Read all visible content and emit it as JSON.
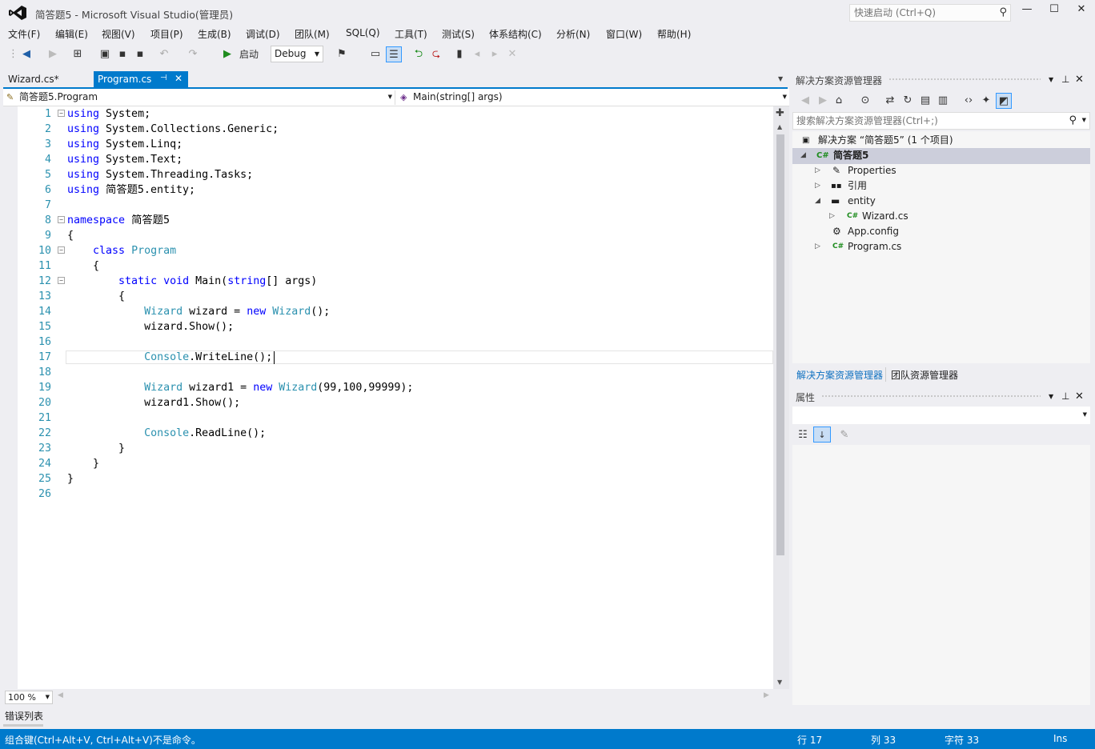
{
  "window": {
    "title": "简答题5 - Microsoft Visual Studio(管理员)",
    "quick_launch_placeholder": "快速启动 (Ctrl+Q)"
  },
  "menu": [
    "文件(F)",
    "编辑(E)",
    "视图(V)",
    "项目(P)",
    "生成(B)",
    "调试(D)",
    "团队(M)",
    "SQL(Q)",
    "工具(T)",
    "测试(S)",
    "体系结构(C)",
    "分析(N)",
    "窗口(W)",
    "帮助(H)"
  ],
  "toolbar": {
    "start_label": "启动",
    "config": "Debug"
  },
  "tabs": [
    {
      "label": "Wizard.cs*",
      "active": false
    },
    {
      "label": "Program.cs",
      "active": true
    }
  ],
  "navbar": {
    "class_scope": "简答题5.Program",
    "member_scope": "Main(string[] args)"
  },
  "code_lines": [
    {
      "n": "1",
      "code": "using System;"
    },
    {
      "n": "2",
      "code": "using System.Collections.Generic;"
    },
    {
      "n": "3",
      "code": "using System.Linq;"
    },
    {
      "n": "4",
      "code": "using System.Text;"
    },
    {
      "n": "5",
      "code": "using System.Threading.Tasks;"
    },
    {
      "n": "6",
      "code": "using 简答题5.entity;"
    },
    {
      "n": "7",
      "code": ""
    },
    {
      "n": "8",
      "code": "namespace 简答题5"
    },
    {
      "n": "9",
      "code": "{"
    },
    {
      "n": "10",
      "code": "    class Program"
    },
    {
      "n": "11",
      "code": "    {"
    },
    {
      "n": "12",
      "code": "        static void Main(string[] args)"
    },
    {
      "n": "13",
      "code": "        {"
    },
    {
      "n": "14",
      "code": "            Wizard wizard = new Wizard();"
    },
    {
      "n": "15",
      "code": "            wizard.Show();"
    },
    {
      "n": "16",
      "code": ""
    },
    {
      "n": "17",
      "code": "            Console.WriteLine();"
    },
    {
      "n": "18",
      "code": ""
    },
    {
      "n": "19",
      "code": "            Wizard wizard1 = new Wizard(99,100,99999);"
    },
    {
      "n": "20",
      "code": "            wizard1.Show();"
    },
    {
      "n": "21",
      "code": ""
    },
    {
      "n": "22",
      "code": "            Console.ReadLine();"
    },
    {
      "n": "23",
      "code": "        }"
    },
    {
      "n": "24",
      "code": "    }"
    },
    {
      "n": "25",
      "code": "}"
    },
    {
      "n": "26",
      "code": ""
    }
  ],
  "zoom": "100 %",
  "error_list_label": "错误列表",
  "status": {
    "message": "组合键(Ctrl+Alt+V, Ctrl+Alt+V)不是命令。",
    "line": "行 17",
    "col": "列 33",
    "char": "字符 33",
    "mode": "Ins"
  },
  "solution_explorer": {
    "title": "解决方案资源管理器",
    "search_placeholder": "搜索解决方案资源管理器(Ctrl+;)",
    "tree": [
      {
        "label": "解决方案 “简答题5” (1 个项目)",
        "icon": "solution-icon"
      },
      {
        "label": "简答题5",
        "icon": "csharp-project-icon"
      },
      {
        "label": "Properties",
        "icon": "wrench-icon"
      },
      {
        "label": "引用",
        "icon": "references-icon"
      },
      {
        "label": "entity",
        "icon": "folder-icon"
      },
      {
        "label": "Wizard.cs",
        "icon": "csharp-file-icon"
      },
      {
        "label": "App.config",
        "icon": "config-icon"
      },
      {
        "label": "Program.cs",
        "icon": "csharp-file-icon"
      }
    ],
    "tab_solution": "解决方案资源管理器",
    "tab_team": "团队资源管理器"
  },
  "properties": {
    "title": "属性"
  },
  "colors": {
    "accent": "#007acc",
    "keyword": "#0000ff",
    "type": "#2b91af"
  }
}
